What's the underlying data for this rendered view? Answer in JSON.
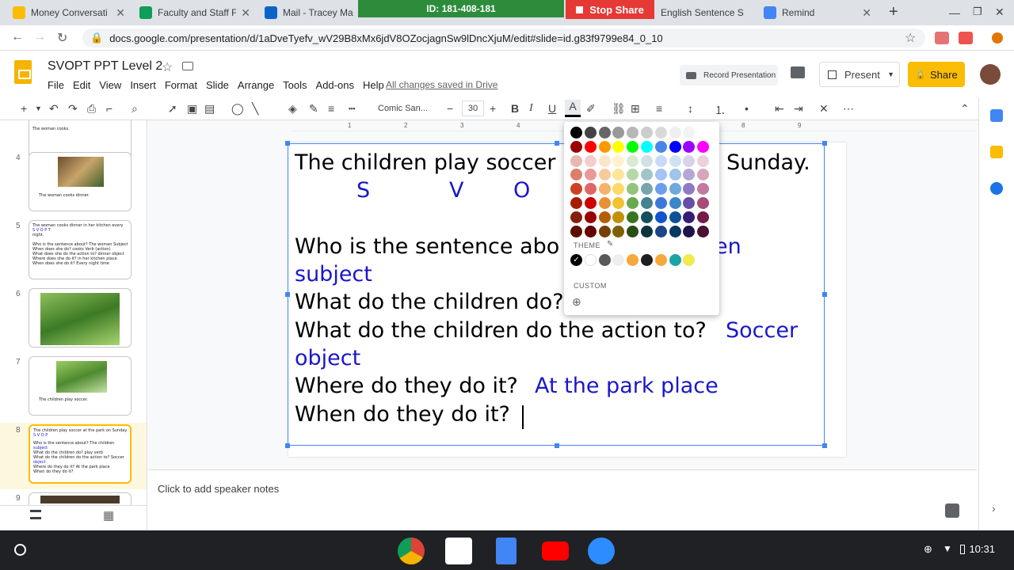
{
  "browser": {
    "tabs": [
      {
        "title": "Money Conversati",
        "color": "#fbbc04"
      },
      {
        "title": "Faculty and Staff F",
        "color": "#0f9d58"
      },
      {
        "title": "Mail - Tracey Maur",
        "color": "#0a64c8"
      },
      {
        "title": "English Sentence S",
        "color": "#fbbc04"
      },
      {
        "title": "Remind",
        "color": "#4285f4"
      }
    ],
    "new_tab_symbol": "+",
    "url": "docs.google.com/presentation/d/1aDveTyefv_wV29B8xMx6jdV8OZocjagnSw9lDncXjuM/edit#slide=id.g83f9799e84_0_10",
    "zoom_meeting_id": "ID: 181-408-181",
    "stop_share_label": "Stop Share"
  },
  "app": {
    "doc_title": "SVOPT PPT Level 2",
    "menu": [
      "File",
      "Edit",
      "View",
      "Insert",
      "Format",
      "Slide",
      "Arrange",
      "Tools",
      "Add-ons",
      "Help"
    ],
    "save_status": "All changes saved in Drive",
    "record_label": "Record Presentation",
    "present_label": "Present",
    "share_label": "Share"
  },
  "toolbar": {
    "font": "Comic San...",
    "font_size": "30"
  },
  "ruler_ticks": [
    "1",
    "2",
    "3",
    "4",
    "5",
    "6",
    "7",
    "8",
    "9"
  ],
  "filmstrip": [
    {
      "num": "",
      "lines": [
        "The woman cooks."
      ]
    },
    {
      "num": "4",
      "lines": [
        "The woman cooks dinner."
      ]
    },
    {
      "num": "5",
      "lines": [
        "The woman cooks dinner in her kitchen every",
        "      S        V       O        P        T",
        "night.",
        "Who is the sentence about? The woman Subject",
        "When does she do? cooks Verb (action)",
        "What does she do the action to? dinner object",
        "Where does she do it? in her kitchen place",
        "When does she do it? Every night time"
      ]
    },
    {
      "num": "6",
      "lines": []
    },
    {
      "num": "7",
      "lines": [
        "The children play soccer."
      ]
    },
    {
      "num": "8",
      "lines": [
        "The children play soccer at the park on Sunday.",
        "      S        V        O         P",
        "Who is the sentence about? The children",
        "subject",
        "What do the children do? play verb",
        "What do the children do the action to? Soccer",
        "object",
        "Where do they do it? At the park place",
        "When do they do it?"
      ]
    },
    {
      "num": "9",
      "lines": []
    }
  ],
  "slide": {
    "line1_left": "The children play soccer",
    "line1_right": "Sunday.",
    "markers": [
      "S",
      "V",
      "O"
    ],
    "q1": "Who is the sentence abo",
    "q1_answer_partial": "en",
    "q1_answer_2": "subject",
    "q2": "What do the children do?",
    "q3": "What do the children do the action to?",
    "q3_answer": "Soccer",
    "q3_answer_2": "object",
    "q4": "Where do they do it?",
    "q4_answer": "At the park place",
    "q5": "When do they do it?"
  },
  "notes_placeholder": "Click to add speaker notes",
  "color_palette": {
    "theme_label": "THEME",
    "custom_label": "CUSTOM",
    "rows": [
      [
        "#000000",
        "#434343",
        "#666666",
        "#999999",
        "#b7b7b7",
        "#cccccc",
        "#d9d9d9",
        "#efefef",
        "#f3f3f3",
        "#ffffff"
      ],
      [
        "#980000",
        "#ff0000",
        "#ff9900",
        "#ffff00",
        "#00ff00",
        "#00ffff",
        "#4a86e8",
        "#0000ff",
        "#9900ff",
        "#ff00ff"
      ],
      [
        "#e6b8af",
        "#f4cccc",
        "#fce5cd",
        "#fff2cc",
        "#d9ead3",
        "#d0e0e3",
        "#c9daf8",
        "#cfe2f3",
        "#d9d2e9",
        "#ead1dc"
      ],
      [
        "#dd7e6b",
        "#ea9999",
        "#f9cb9c",
        "#ffe599",
        "#b6d7a8",
        "#a2c4c9",
        "#a4c2f4",
        "#9fc5e8",
        "#b4a7d6",
        "#d5a6bd"
      ],
      [
        "#cc4125",
        "#e06666",
        "#f6b26b",
        "#ffd966",
        "#93c47d",
        "#76a5af",
        "#6d9eeb",
        "#6fa8dc",
        "#8e7cc3",
        "#c27ba0"
      ],
      [
        "#a61c00",
        "#cc0000",
        "#e69138",
        "#f1c232",
        "#6aa84f",
        "#45818e",
        "#3c78d8",
        "#3d85c6",
        "#674ea7",
        "#a64d79"
      ],
      [
        "#85200c",
        "#990000",
        "#b45f06",
        "#bf9000",
        "#38761d",
        "#134f5c",
        "#1155cc",
        "#0b5394",
        "#351c75",
        "#741b47"
      ],
      [
        "#5b0f00",
        "#660000",
        "#783f04",
        "#7f6000",
        "#274e13",
        "#0c343d",
        "#1c4587",
        "#073763",
        "#20124d",
        "#4c1130"
      ]
    ],
    "theme_colors": [
      "#000000",
      "#ffffff",
      "#595959",
      "#eeeeee",
      "#f6a83b",
      "#1e1e1e",
      "#f6a83b",
      "#1ca3a3",
      "#f2e94e"
    ]
  },
  "shelf": {
    "time": "10:31",
    "apps": [
      "chrome",
      "gmail",
      "docs",
      "youtube",
      "zoom"
    ]
  }
}
